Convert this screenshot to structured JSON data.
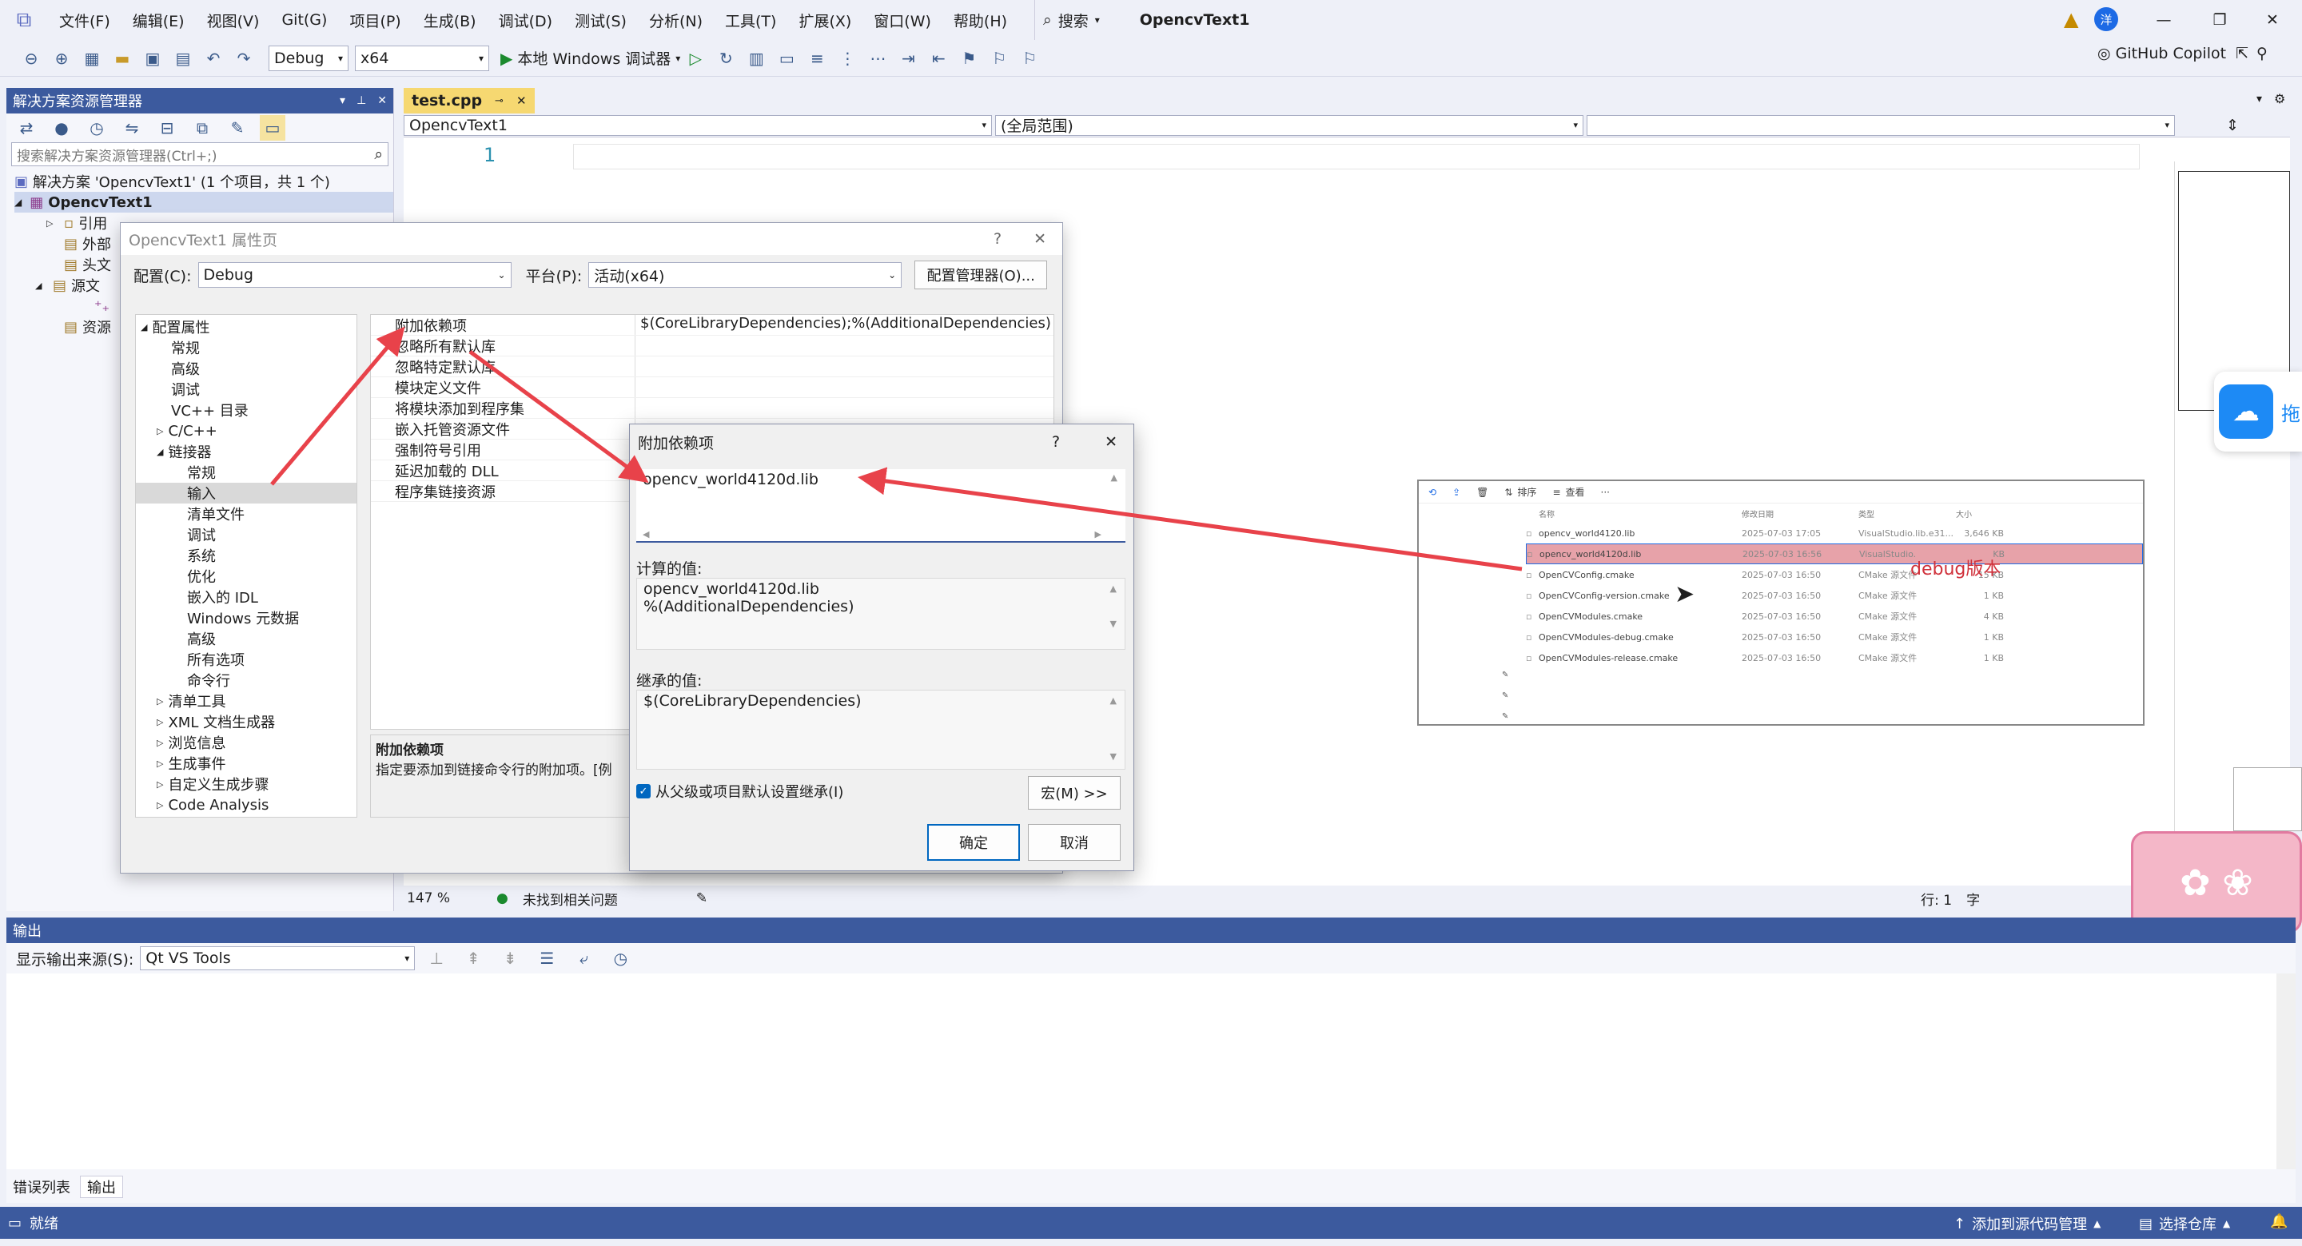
{
  "menu": {
    "items": [
      "文件(F)",
      "编辑(E)",
      "视图(V)",
      "Git(G)",
      "项目(P)",
      "生成(B)",
      "调试(D)",
      "测试(S)",
      "分析(N)",
      "工具(T)",
      "扩展(X)",
      "窗口(W)",
      "帮助(H)"
    ],
    "search": "搜索",
    "project_title": "OpencvText1",
    "user_initial": "洋"
  },
  "toolbar": {
    "config": "Debug",
    "platform": "x64",
    "run_label": "本地 Windows 调试器",
    "copilot": "GitHub Copilot"
  },
  "solution_explorer": {
    "title": "解决方案资源管理器",
    "search_placeholder": "搜索解决方案资源管理器(Ctrl+;)",
    "solution": "解决方案 'OpencvText1' (1 个项目，共 1 个)",
    "project": "OpencvText1",
    "nodes": [
      "引用",
      "外部",
      "头文",
      "源文",
      "资源"
    ]
  },
  "editor": {
    "tab": "test.cpp",
    "nav_project": "OpencvText1",
    "nav_scope": "(全局范围)",
    "line_number": "1",
    "zoom": "147 %",
    "issues": "未找到相关问题",
    "line_col": "行: 1",
    "char": "字"
  },
  "prop_dialog": {
    "title": "OpencvText1 属性页",
    "config_label": "配置(C):",
    "config_value": "Debug",
    "platform_label": "平台(P):",
    "platform_value": "活动(x64)",
    "config_manager": "配置管理器(O)...",
    "tree": {
      "root": "配置属性",
      "items": [
        "常规",
        "高级",
        "调试",
        "VC++ 目录"
      ],
      "cpp": "C/C++",
      "linker": "链接器",
      "linker_items": [
        "常规",
        "输入",
        "清单文件",
        "调试",
        "系统",
        "优化",
        "嵌入的 IDL",
        "Windows 元数据",
        "高级",
        "所有选项",
        "命令行"
      ],
      "more": [
        "清单工具",
        "XML 文档生成器",
        "浏览信息",
        "生成事件",
        "自定义生成步骤",
        "Code Analysis"
      ]
    },
    "props": [
      {
        "k": "附加依赖项",
        "v": "$(CoreLibraryDependencies);%(AdditionalDependencies)"
      },
      {
        "k": "忽略所有默认库",
        "v": ""
      },
      {
        "k": "忽略特定默认库",
        "v": ""
      },
      {
        "k": "模块定义文件",
        "v": ""
      },
      {
        "k": "将模块添加到程序集",
        "v": ""
      },
      {
        "k": "嵌入托管资源文件",
        "v": ""
      },
      {
        "k": "强制符号引用",
        "v": ""
      },
      {
        "k": "延迟加载的 DLL",
        "v": ""
      },
      {
        "k": "程序集链接资源",
        "v": ""
      }
    ],
    "desc_title": "附加依赖项",
    "desc_text": "指定要添加到链接命令行的附加项。[例"
  },
  "dep_dialog": {
    "title": "附加依赖项",
    "help": "?",
    "value": "opencv_world4120d.lib",
    "computed_label": "计算的值:",
    "computed_1": "opencv_world4120d.lib",
    "computed_2": "%(AdditionalDependencies)",
    "inherited_label": "继承的值:",
    "inherited": "$(CoreLibraryDependencies)",
    "inherit_check": "从父级或项目默认设置继承(I)",
    "macro": "宏(M) >>",
    "ok": "确定",
    "cancel": "取消"
  },
  "explorer": {
    "sort": "排序",
    "view": "查看",
    "more": "···",
    "headers": [
      "名称",
      "修改日期",
      "类型",
      "大小"
    ],
    "annotation": "debug版本",
    "rows": [
      {
        "name": "opencv_world4120.lib",
        "date": "2025-07-03 17:05",
        "type": "VisualStudio.lib.e31...",
        "size": "3,646 KB"
      },
      {
        "name": "opencv_world4120d.lib",
        "date": "2025-07-03 16:56",
        "type": "VisualStudio.",
        "size": "KB"
      },
      {
        "name": "OpenCVConfig.cmake",
        "date": "2025-07-03 16:50",
        "type": "CMake 源文件",
        "size": "15 KB"
      },
      {
        "name": "OpenCVConfig-version.cmake",
        "date": "2025-07-03 16:50",
        "type": "CMake 源文件",
        "size": "1 KB"
      },
      {
        "name": "OpenCVModules.cmake",
        "date": "2025-07-03 16:50",
        "type": "CMake 源文件",
        "size": "4 KB"
      },
      {
        "name": "OpenCVModules-debug.cmake",
        "date": "2025-07-03 16:50",
        "type": "CMake 源文件",
        "size": "1 KB"
      },
      {
        "name": "OpenCVModules-release.cmake",
        "date": "2025-07-03 16:50",
        "type": "CMake 源文件",
        "size": "1 KB"
      }
    ]
  },
  "side_widget": {
    "label": "拖"
  },
  "output": {
    "title": "输出",
    "source_label": "显示输出来源(S):",
    "source_value": "Qt VS Tools",
    "tabs": [
      "错误列表",
      "输出"
    ]
  },
  "status": {
    "ready": "就绪",
    "add_source": "添加到源代码管理",
    "select_repo": "选择仓库"
  },
  "colors": {
    "accent": "#3c5a9e",
    "arrow": "#e8424a",
    "annotation": "#d0303a",
    "highlight_row": "#e7a2a9"
  }
}
